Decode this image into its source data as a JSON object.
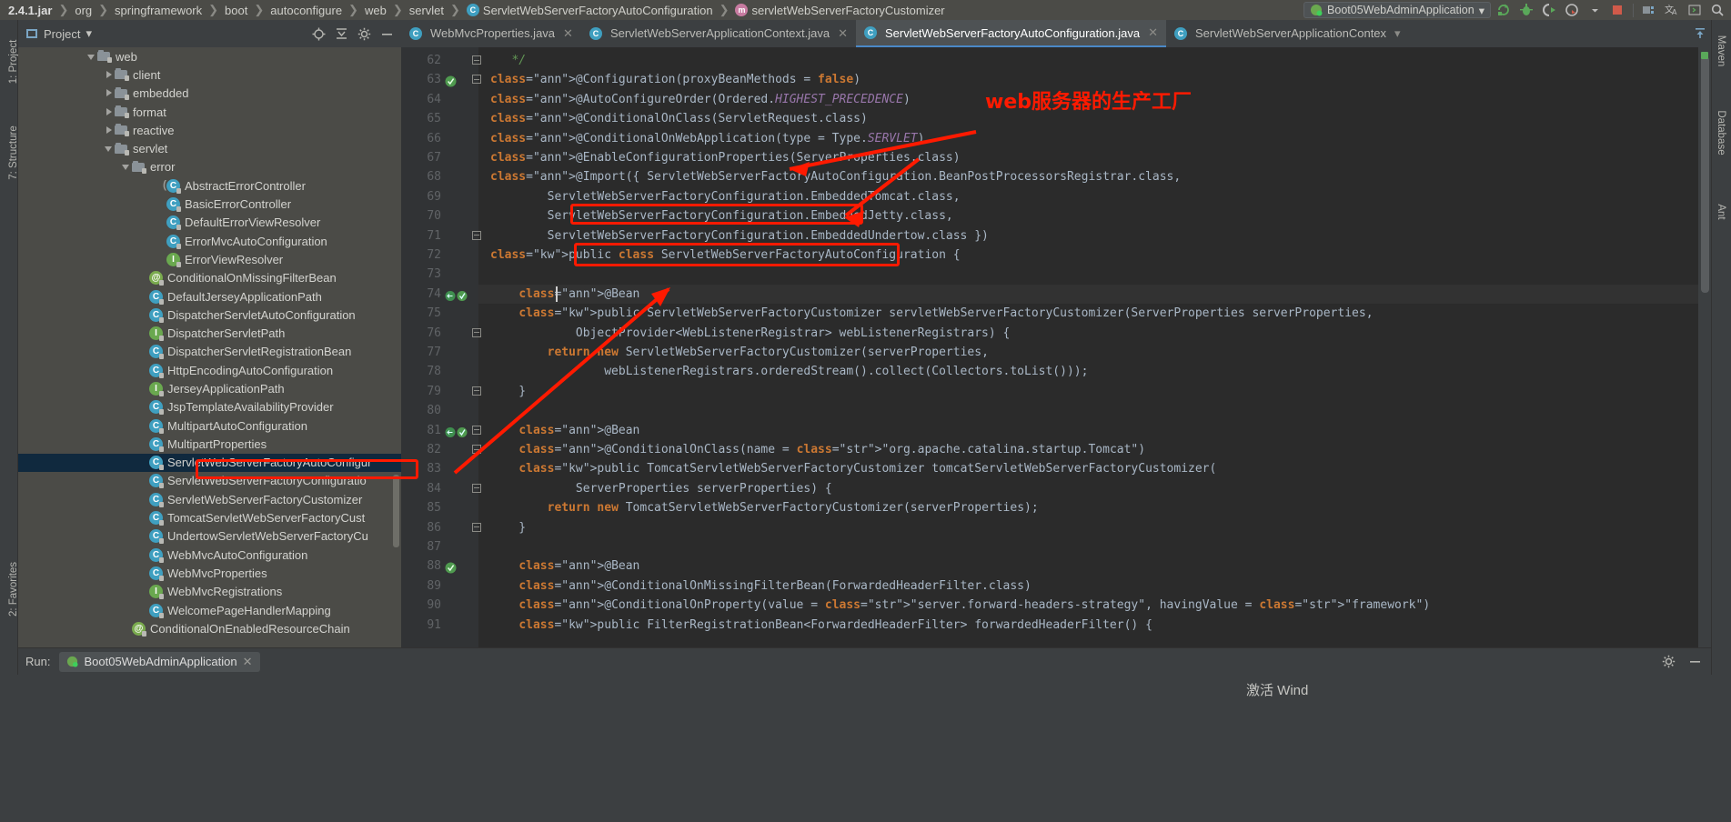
{
  "breadcrumb": {
    "items": [
      {
        "label": "2.4.1.jar",
        "icon": null,
        "bold": true
      },
      {
        "label": "org",
        "icon": null,
        "bold": false
      },
      {
        "label": "springframework",
        "icon": null,
        "bold": false
      },
      {
        "label": "boot",
        "icon": null,
        "bold": false
      },
      {
        "label": "autoconfigure",
        "icon": null,
        "bold": false
      },
      {
        "label": "web",
        "icon": null,
        "bold": false
      },
      {
        "label": "servlet",
        "icon": null,
        "bold": false
      },
      {
        "label": "ServletWebServerFactoryAutoConfiguration",
        "icon": "class-icon",
        "bold": false
      },
      {
        "label": "servletWebServerFactoryCustomizer",
        "icon": "method-icon",
        "bold": false
      }
    ]
  },
  "toolbar": {
    "run_configuration": "Boot05WebAdminApplication",
    "dropdown_caret": "▾",
    "buttons": [
      {
        "name": "rerun-icon",
        "title": "Rerun"
      },
      {
        "name": "debug-icon",
        "title": "Debug"
      },
      {
        "name": "run-with-coverage-icon",
        "title": "Run with Coverage"
      },
      {
        "name": "profiler-icon",
        "title": "Profiler"
      },
      {
        "name": "stop-icon",
        "title": "Stop"
      },
      {
        "name": "project-structure-icon",
        "title": "Project Structure"
      },
      {
        "name": "translate-icon",
        "title": "Translate"
      },
      {
        "name": "terminal-icon",
        "title": "Terminal"
      },
      {
        "name": "search-everywhere-icon",
        "title": "Search Everywhere"
      }
    ]
  },
  "left_strip": {
    "top_label": "1: Project",
    "mid_label": "7: Structure",
    "bottom_label": "2: Favorites"
  },
  "right_strip": {
    "labels": [
      "Maven",
      "Database",
      "Ant"
    ]
  },
  "project_panel": {
    "title": "Project",
    "caret": "▾",
    "header_icons": [
      "locate-icon",
      "collapse-all-icon",
      "settings-icon",
      "hide-icon"
    ]
  },
  "tree": {
    "items": [
      {
        "label": "web",
        "indent": 4,
        "toggle": "down",
        "type": "folder"
      },
      {
        "label": "client",
        "indent": 5,
        "toggle": "right",
        "type": "folder"
      },
      {
        "label": "embedded",
        "indent": 5,
        "toggle": "right",
        "type": "folder"
      },
      {
        "label": "format",
        "indent": 5,
        "toggle": "right",
        "type": "folder"
      },
      {
        "label": "reactive",
        "indent": 5,
        "toggle": "right",
        "type": "folder"
      },
      {
        "label": "servlet",
        "indent": 5,
        "toggle": "down",
        "type": "folder"
      },
      {
        "label": "error",
        "indent": 6,
        "toggle": "down",
        "type": "folder"
      },
      {
        "label": "AbstractErrorController",
        "indent": 8,
        "toggle": "none",
        "type": "abstract-class"
      },
      {
        "label": "BasicErrorController",
        "indent": 8,
        "toggle": "none",
        "type": "class"
      },
      {
        "label": "DefaultErrorViewResolver",
        "indent": 8,
        "toggle": "none",
        "type": "class"
      },
      {
        "label": "ErrorMvcAutoConfiguration",
        "indent": 8,
        "toggle": "none",
        "type": "class"
      },
      {
        "label": "ErrorViewResolver",
        "indent": 8,
        "toggle": "none",
        "type": "interface"
      },
      {
        "label": "ConditionalOnMissingFilterBean",
        "indent": 7,
        "toggle": "none",
        "type": "annotation"
      },
      {
        "label": "DefaultJerseyApplicationPath",
        "indent": 7,
        "toggle": "none",
        "type": "class"
      },
      {
        "label": "DispatcherServletAutoConfiguration",
        "indent": 7,
        "toggle": "none",
        "type": "class"
      },
      {
        "label": "DispatcherServletPath",
        "indent": 7,
        "toggle": "none",
        "type": "interface"
      },
      {
        "label": "DispatcherServletRegistrationBean",
        "indent": 7,
        "toggle": "none",
        "type": "class"
      },
      {
        "label": "HttpEncodingAutoConfiguration",
        "indent": 7,
        "toggle": "none",
        "type": "class"
      },
      {
        "label": "JerseyApplicationPath",
        "indent": 7,
        "toggle": "none",
        "type": "interface"
      },
      {
        "label": "JspTemplateAvailabilityProvider",
        "indent": 7,
        "toggle": "none",
        "type": "class"
      },
      {
        "label": "MultipartAutoConfiguration",
        "indent": 7,
        "toggle": "none",
        "type": "class"
      },
      {
        "label": "MultipartProperties",
        "indent": 7,
        "toggle": "none",
        "type": "class"
      },
      {
        "label": "ServletWebServerFactoryAutoConfigur",
        "indent": 7,
        "toggle": "none",
        "type": "class",
        "selected": true
      },
      {
        "label": "ServletWebServerFactoryConfiguratio",
        "indent": 7,
        "toggle": "none",
        "type": "class"
      },
      {
        "label": "ServletWebServerFactoryCustomizer",
        "indent": 7,
        "toggle": "none",
        "type": "class"
      },
      {
        "label": "TomcatServletWebServerFactoryCust",
        "indent": 7,
        "toggle": "none",
        "type": "class"
      },
      {
        "label": "UndertowServletWebServerFactoryCu",
        "indent": 7,
        "toggle": "none",
        "type": "class"
      },
      {
        "label": "WebMvcAutoConfiguration",
        "indent": 7,
        "toggle": "none",
        "type": "class"
      },
      {
        "label": "WebMvcProperties",
        "indent": 7,
        "toggle": "none",
        "type": "class"
      },
      {
        "label": "WebMvcRegistrations",
        "indent": 7,
        "toggle": "none",
        "type": "interface"
      },
      {
        "label": "WelcomePageHandlerMapping",
        "indent": 7,
        "toggle": "none",
        "type": "class"
      },
      {
        "label": "ConditionalOnEnabledResourceChain",
        "indent": 6,
        "toggle": "none",
        "type": "annotation"
      }
    ]
  },
  "editor_tabs": [
    {
      "label": "WebMvcProperties.java",
      "icon": "class-icon",
      "active": false,
      "close": "✕"
    },
    {
      "label": "ServletWebServerApplicationContext.java",
      "icon": "class-icon",
      "active": false,
      "close": "✕"
    },
    {
      "label": "ServletWebServerFactoryAutoConfiguration.java",
      "icon": "class-icon",
      "active": true,
      "close": "✕"
    },
    {
      "label": "ServletWebServerApplicationContex",
      "icon": "class-icon",
      "active": false,
      "close": "▾"
    }
  ],
  "code": {
    "first_line": 62,
    "lines": [
      {
        "n": 62,
        "indent": 0,
        "html": "   */",
        "cls": "cmt",
        "fold": "end"
      },
      {
        "n": 63,
        "indent": 0,
        "html": "@Configuration(proxyBeanMethods = false)",
        "gutter": "bean-icon",
        "fold": "start"
      },
      {
        "n": 64,
        "indent": 0,
        "html": "@AutoConfigureOrder(Ordered.HIGHEST_PRECEDENCE)"
      },
      {
        "n": 65,
        "indent": 0,
        "html": "@ConditionalOnClass(ServletRequest.class)"
      },
      {
        "n": 66,
        "indent": 0,
        "html": "@ConditionalOnWebApplication(type = Type.SERVLET)"
      },
      {
        "n": 67,
        "indent": 0,
        "html": "@EnableConfigurationProperties(ServerProperties.class)"
      },
      {
        "n": 68,
        "indent": 0,
        "html": "@Import({ ServletWebServerFactoryAutoConfiguration.BeanPostProcessorsRegistrar.class,"
      },
      {
        "n": 69,
        "indent": 0,
        "html": "        ServletWebServerFactoryConfiguration.EmbeddedTomcat.class,"
      },
      {
        "n": 70,
        "indent": 0,
        "html": "        ServletWebServerFactoryConfiguration.EmbeddedJetty.class,"
      },
      {
        "n": 71,
        "indent": 0,
        "html": "        ServletWebServerFactoryConfiguration.EmbeddedUndertow.class })",
        "fold": "end"
      },
      {
        "n": 72,
        "indent": 0,
        "html": "public class ServletWebServerFactoryAutoConfiguration {"
      },
      {
        "n": 73,
        "indent": 0,
        "html": ""
      },
      {
        "n": 74,
        "indent": 0,
        "html": "    @Bean",
        "gutter": "bean-override",
        "current": true
      },
      {
        "n": 75,
        "indent": 0,
        "html": "    public ServletWebServerFactoryCustomizer servletWebServerFactoryCustomizer(ServerProperties serverProperties,"
      },
      {
        "n": 76,
        "indent": 0,
        "html": "            ObjectProvider<WebListenerRegistrar> webListenerRegistrars) {",
        "fold": "start"
      },
      {
        "n": 77,
        "indent": 0,
        "html": "        return new ServletWebServerFactoryCustomizer(serverProperties,"
      },
      {
        "n": 78,
        "indent": 0,
        "html": "                webListenerRegistrars.orderedStream().collect(Collectors.toList()));"
      },
      {
        "n": 79,
        "indent": 0,
        "html": "    }",
        "fold": "end"
      },
      {
        "n": 80,
        "indent": 0,
        "html": ""
      },
      {
        "n": 81,
        "indent": 0,
        "html": "    @Bean",
        "gutter": "bean-override",
        "fold": "start"
      },
      {
        "n": 82,
        "indent": 0,
        "html": "    @ConditionalOnClass(name = \"org.apache.catalina.startup.Tomcat\")",
        "fold": "end"
      },
      {
        "n": 83,
        "indent": 0,
        "html": "    public TomcatServletWebServerFactoryCustomizer tomcatServletWebServerFactoryCustomizer("
      },
      {
        "n": 84,
        "indent": 0,
        "html": "            ServerProperties serverProperties) {",
        "fold": "start"
      },
      {
        "n": 85,
        "indent": 0,
        "html": "        return new TomcatServletWebServerFactoryCustomizer(serverProperties);"
      },
      {
        "n": 86,
        "indent": 0,
        "html": "    }",
        "fold": "end"
      },
      {
        "n": 87,
        "indent": 0,
        "html": ""
      },
      {
        "n": 88,
        "indent": 0,
        "html": "    @Bean",
        "gutter": "bean-icon"
      },
      {
        "n": 89,
        "indent": 0,
        "html": "    @ConditionalOnMissingFilterBean(ForwardedHeaderFilter.class)"
      },
      {
        "n": 90,
        "indent": 0,
        "html": "    @ConditionalOnProperty(value = \"server.forward-headers-strategy\", havingValue = \"framework\")"
      },
      {
        "n": 91,
        "indent": 0,
        "html": "    public FilterRegistrationBean<ForwardedHeaderFilter> forwardedHeaderFilter() {"
      }
    ]
  },
  "annotations": {
    "chinese_note": "web服务器的生产工厂",
    "note_color": "#ff1a00",
    "boxes": [
      {
        "name": "highlight-box-import-jetty"
      },
      {
        "name": "highlight-box-class-decl"
      },
      {
        "name": "highlight-box-tree-selected"
      }
    ],
    "arrows": [
      {
        "name": "arrow-to-enable-config-properties"
      },
      {
        "name": "arrow-to-embedded-jetty"
      },
      {
        "name": "arrow-to-tree-item"
      }
    ]
  },
  "run_panel": {
    "label": "Run:",
    "tab": "Boot05WebAdminApplication",
    "tab_close": "✕",
    "right_icons": [
      "settings-icon",
      "minimize-icon"
    ]
  },
  "status": {
    "activate_text": "激活 Wind"
  },
  "colors": {
    "accent_red": "#ff1a00",
    "tab_active_underline": "#4a88c7",
    "editor_bg": "#2b2b2b",
    "panel_bg": "#4b4b47",
    "chrome_bg": "#3c3f41",
    "selection_blue": "#10293e"
  }
}
